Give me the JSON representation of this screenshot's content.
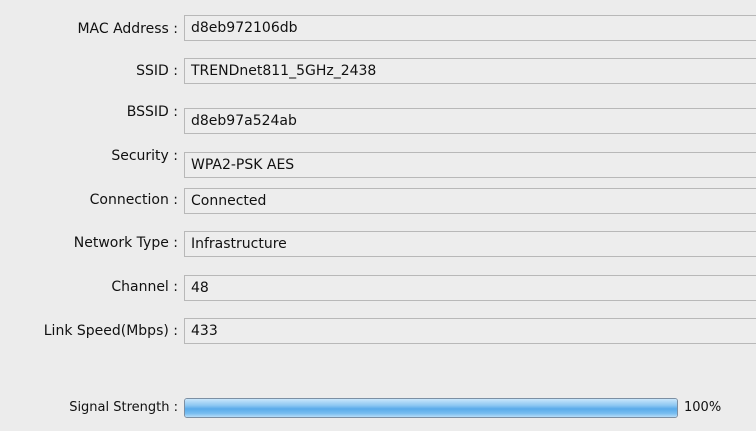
{
  "info": {
    "mac": {
      "label": "MAC Address :",
      "value": "d8eb972106db"
    },
    "ssid": {
      "label": "SSID :",
      "value": "TRENDnet811_5GHz_2438"
    },
    "bssid": {
      "label": "BSSID :",
      "value": "d8eb97a524ab"
    },
    "security": {
      "label": "Security :",
      "value": "WPA2-PSK AES"
    },
    "connection": {
      "label": "Connection :",
      "value": "Connected"
    },
    "network_type": {
      "label": "Network Type :",
      "value": "Infrastructure"
    },
    "channel": {
      "label": "Channel :",
      "value": "48"
    },
    "link_speed": {
      "label": "Link Speed(Mbps) :",
      "value": "433"
    }
  },
  "signal": {
    "label": "Signal Strength :",
    "percent_text": "100%",
    "level": 1.0,
    "fill_color": "#5aabea"
  }
}
